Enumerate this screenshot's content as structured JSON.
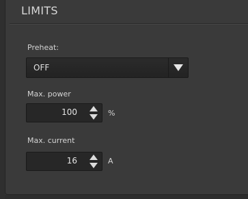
{
  "panel": {
    "title": "LIMITS"
  },
  "preheat": {
    "label": "Preheat:",
    "selected": "OFF"
  },
  "max_power": {
    "label": "Max. power",
    "value": "100",
    "unit": "%"
  },
  "max_current": {
    "label": "Max. current",
    "value": "16",
    "unit": "A"
  },
  "icons": {
    "dropdown": "triangle-down-icon",
    "spin_up": "triangle-up-icon",
    "spin_down": "triangle-down-icon"
  },
  "colors": {
    "panel_bg": "#3a3a3a",
    "field_bg": "#272727",
    "text": "#d4d4d4"
  }
}
